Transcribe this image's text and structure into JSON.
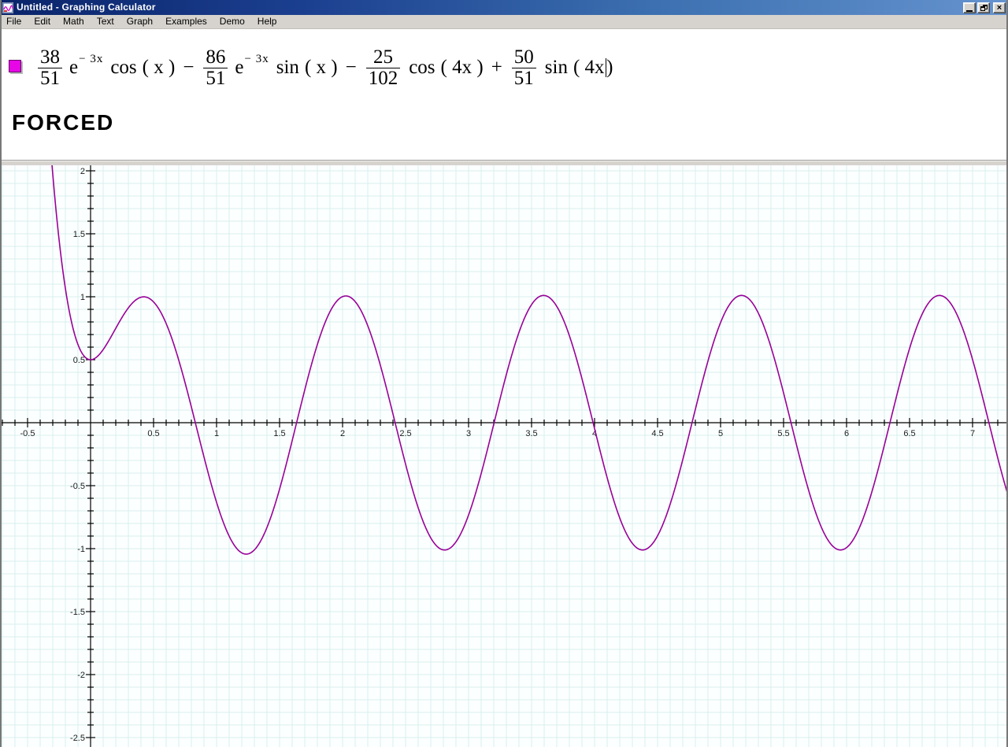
{
  "window": {
    "title": "Untitled - Graphing Calculator",
    "close_glyph": "×"
  },
  "menu": {
    "items": [
      "File",
      "Edit",
      "Math",
      "Text",
      "Graph",
      "Examples",
      "Demo",
      "Help"
    ]
  },
  "equation": {
    "marker_color": "#e606e6",
    "t1_num": "38",
    "t1_den": "51",
    "t1_base": "e",
    "t1_exp": "− 3x",
    "t1_fn": "cos",
    "t1_arg": "( x )",
    "op1": "−",
    "t2_num": "86",
    "t2_den": "51",
    "t2_base": "e",
    "t2_exp": "− 3x",
    "t2_fn": "sin",
    "t2_arg": "( x )",
    "op2": "−",
    "t3_num": "25",
    "t3_den": "102",
    "t3_fn": "cos",
    "t3_arg": "( 4x )",
    "op3": "+",
    "t4_num": "50",
    "t4_den": "51",
    "t4_fn": "sin",
    "t4_arg": "( 4x",
    "t4_close": ")"
  },
  "note": {
    "text": "FORCED"
  },
  "chart_data": {
    "type": "line",
    "title": "",
    "expression": "y = 38/51·e^(−3x)·cos(x) − 86/51·e^(−3x)·sin(x) − 25/102·cos(4x) + 50/51·sin(4x)",
    "model": {
      "a": 0.745098039,
      "b": -1.68627451,
      "k": -3,
      "c": -0.245098039,
      "d": 0.980392157,
      "omega": 4
    },
    "x_range": [
      -0.71875,
      7.28125
    ],
    "y_range": [
      -2.575,
      2.04375
    ],
    "grid": true,
    "grid_step": 0.1,
    "tick_step": 0.1,
    "label_step": 0.5,
    "samples": 1600,
    "x_axis_labels": [
      "-0.5",
      "0.5",
      "1",
      "1.5",
      "2",
      "2.5",
      "3",
      "3.5",
      "4",
      "4.5",
      "5",
      "5.5",
      "6",
      "6.5",
      "7"
    ],
    "y_axis_labels": [
      "2",
      "1.5",
      "1",
      "0.5",
      "-0.5",
      "-1",
      "-1.5",
      "-2",
      "-2.5"
    ],
    "key_points": [
      {
        "x": 0,
        "y": 0.5,
        "comment": "initial value, local minimum"
      },
      {
        "x": 0.45,
        "y": 1.0,
        "comment": "first crest"
      },
      {
        "x": 1.24,
        "y": -1.04,
        "comment": "first trough"
      },
      {
        "x": 2.02,
        "y": 1.01
      },
      {
        "x": 2.81,
        "y": -1.01
      },
      {
        "x": 3.6,
        "y": 1.01
      },
      {
        "x": 4.38,
        "y": -1.01
      },
      {
        "x": 5.17,
        "y": 1.01
      },
      {
        "x": 5.95,
        "y": -1.01
      },
      {
        "x": 6.74,
        "y": 1.01
      }
    ],
    "curve_color": "#990099",
    "axis_color": "#000000",
    "grid_color": "#d7efee",
    "background": "#fcffff",
    "legend_position": "none"
  }
}
